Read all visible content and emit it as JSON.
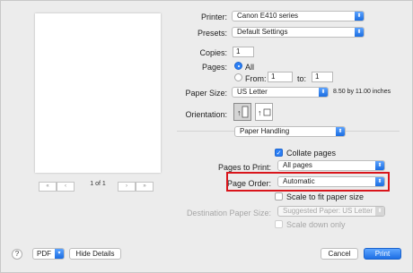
{
  "printer": {
    "label": "Printer:",
    "value": "Canon E410 series"
  },
  "presets": {
    "label": "Presets:",
    "value": "Default Settings"
  },
  "copies": {
    "label": "Copies:",
    "value": "1"
  },
  "pages": {
    "label": "Pages:",
    "all": "All",
    "from_label": "From:",
    "from_value": "1",
    "to_label": "to:",
    "to_value": "1"
  },
  "paper_size": {
    "label": "Paper Size:",
    "value": "US Letter",
    "dims": "8.50 by 11.00 inches"
  },
  "orientation": {
    "label": "Orientation:"
  },
  "section": {
    "value": "Paper Handling"
  },
  "collate": {
    "label": "Collate pages",
    "checked": true
  },
  "pages_to_print": {
    "label": "Pages to Print:",
    "value": "All pages"
  },
  "page_order": {
    "label": "Page Order:",
    "value": "Automatic"
  },
  "scale_fit": {
    "label": "Scale to fit paper size",
    "checked": false
  },
  "dest_paper": {
    "label": "Destination Paper Size:",
    "value": "Suggested Paper: US Letter"
  },
  "scale_down": {
    "label": "Scale down only"
  },
  "pager": {
    "text": "1 of 1",
    "first": "«",
    "prev": "‹",
    "next": "›",
    "last": "»"
  },
  "footer": {
    "help": "?",
    "pdf": "PDF",
    "hide_details": "Hide Details",
    "cancel": "Cancel",
    "print": "Print"
  },
  "colors": {
    "accent": "#2b7ff5",
    "highlight": "#d9151b"
  }
}
